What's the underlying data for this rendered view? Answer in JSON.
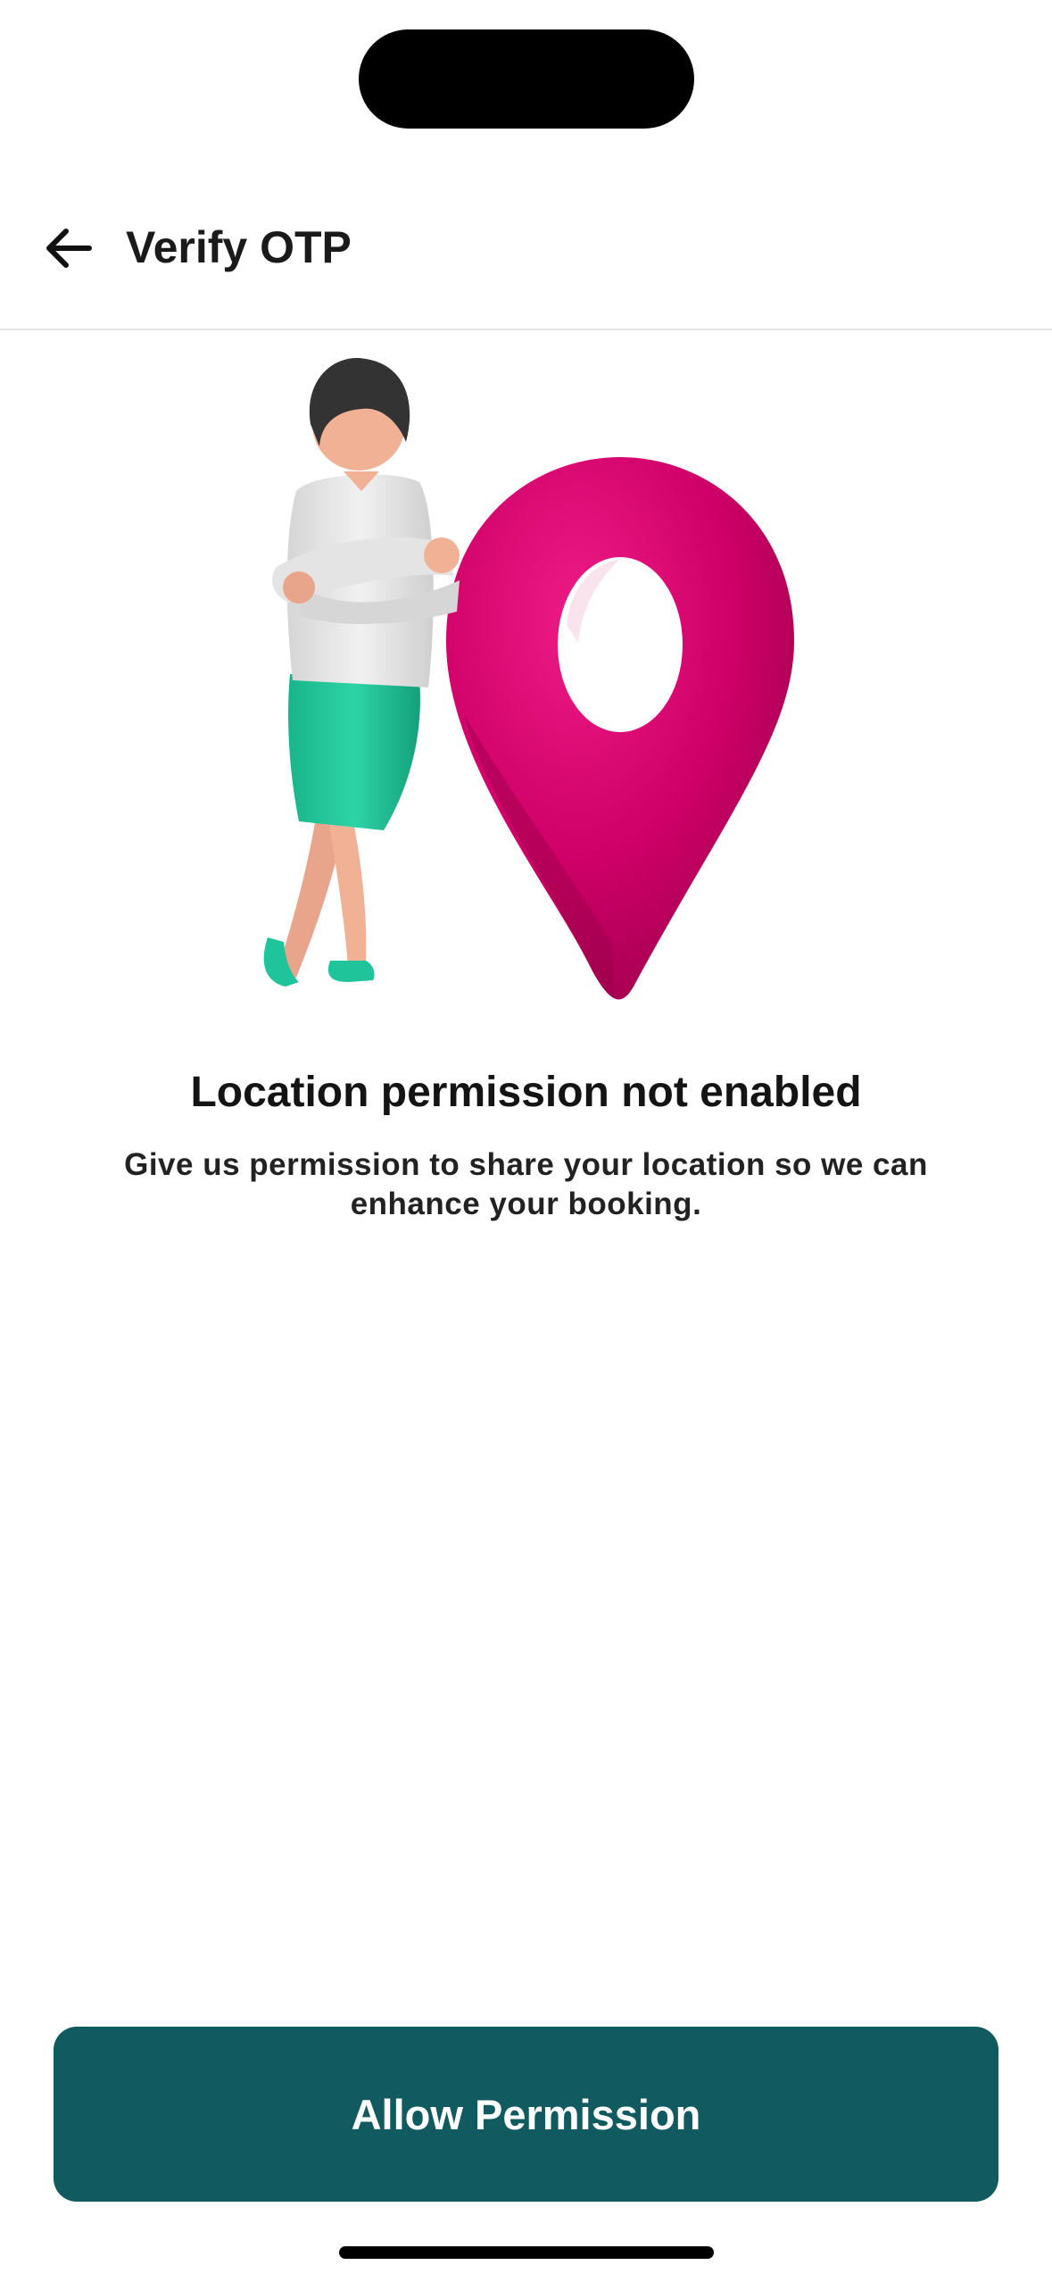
{
  "header": {
    "title": "Verify OTP",
    "back_icon": "arrow-left-icon"
  },
  "illustration": {
    "subject": "woman-leaning-on-location-pin",
    "pin_color": "#c8005f",
    "skirt_color": "#1fbf95"
  },
  "content": {
    "title": "Location permission not enabled",
    "description": "Give us permission to share your location so we can enhance your booking."
  },
  "actions": {
    "allow_label": "Allow Permission",
    "allow_color": "#115a5f"
  }
}
